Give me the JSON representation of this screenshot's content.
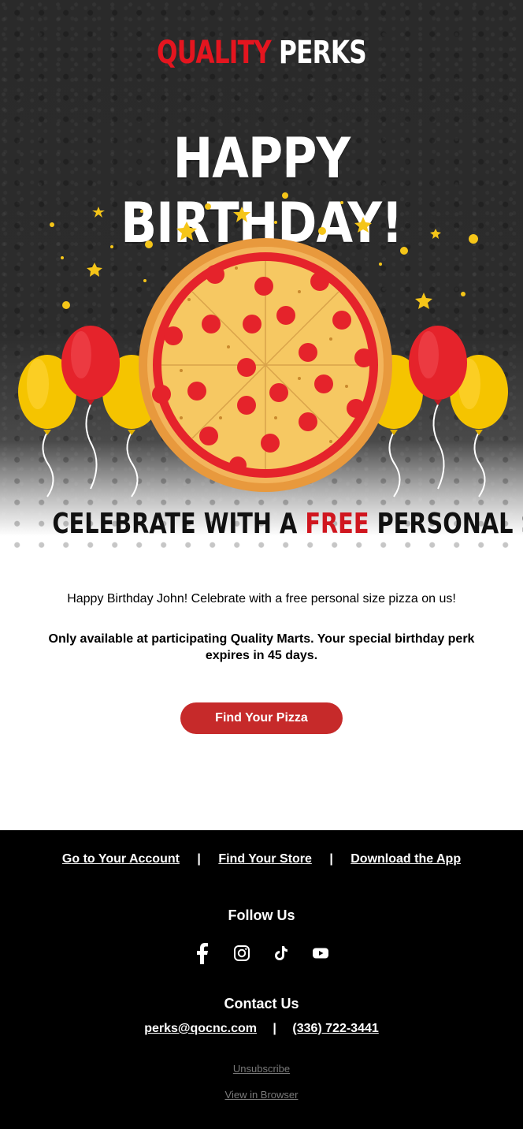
{
  "brand": {
    "logo_part1": "QUALITY",
    "logo_part2": "PERKS",
    "accent_red": "#e4151f"
  },
  "hero": {
    "headline": "HAPPY BIRTHDAY!",
    "subhead_part1": "CELEBRATE WITH A ",
    "subhead_free": "FREE",
    "subhead_part2": " PERSONAL SIZE PIZZA!",
    "illustration": [
      "pizza-icon",
      "balloon-icon",
      "star-icon",
      "confetti-dot"
    ]
  },
  "content": {
    "intro": "Happy Birthday John! Celebrate with a free personal size pizza on us!",
    "note": "Only available at participating Quality Marts. Your special birthday perk expires in 45 days.",
    "cta_label": "Find Your Pizza",
    "cta_color": "#c62a2a"
  },
  "footer": {
    "nav": [
      "Go to Your Account",
      "Find Your Store",
      "Download the App"
    ],
    "separator": "|",
    "follow_title": "Follow Us",
    "social_icons": [
      "facebook-icon",
      "instagram-icon",
      "tiktok-icon",
      "youtube-icon"
    ],
    "contact_title": "Contact Us",
    "email": "perks@qocnc.com",
    "phone": "(336) 722-3441",
    "unsubscribe": "Unsubscribe",
    "view_in_browser": "View in Browser"
  }
}
